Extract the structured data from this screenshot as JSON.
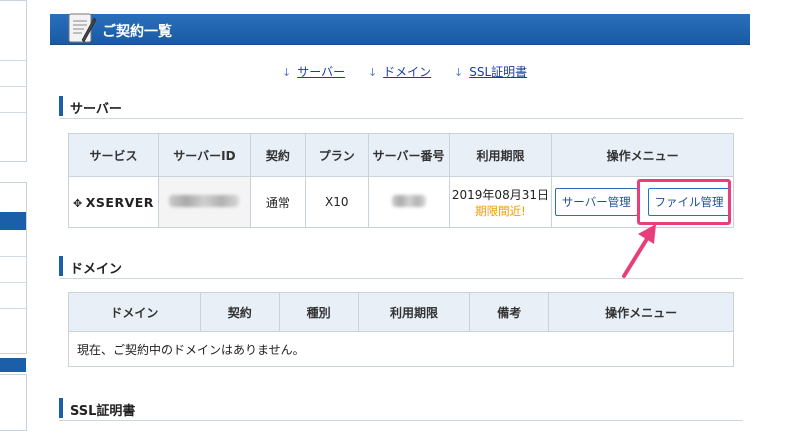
{
  "page": {
    "title": "ご契約一覧",
    "anchors": [
      {
        "label": "サーバー",
        "arrow": "↓"
      },
      {
        "label": "ドメイン",
        "arrow": "↓"
      },
      {
        "label": "SSL証明書",
        "arrow": "↓"
      }
    ]
  },
  "server_section": {
    "title": "サーバー",
    "headers": [
      "サービス",
      "サーバーID",
      "契約",
      "プラン",
      "サーバー番号",
      "利用期限",
      "操作メニュー"
    ],
    "row": {
      "service_logo": "XSERVER",
      "server_id": "",
      "contract": "通常",
      "plan": "X10",
      "server_number": "",
      "expiry_date": "2019年08月31日",
      "expiry_warning": "期限間近!",
      "manage_button": "サーバー管理",
      "file_button": "ファイル管理"
    }
  },
  "domain_section": {
    "title": "ドメイン",
    "headers": [
      "ドメイン",
      "契約",
      "種別",
      "利用期限",
      "備考",
      "操作メニュー"
    ],
    "empty_message": "現在、ご契約中のドメインはありません。"
  },
  "ssl_section": {
    "title": "SSL証明書"
  },
  "colors": {
    "header_blue": "#1b5fa8",
    "link": "#1a3fa0",
    "warning": "#f39800",
    "highlight": "#e83e7a",
    "table_header_bg": "#e8eff7"
  }
}
